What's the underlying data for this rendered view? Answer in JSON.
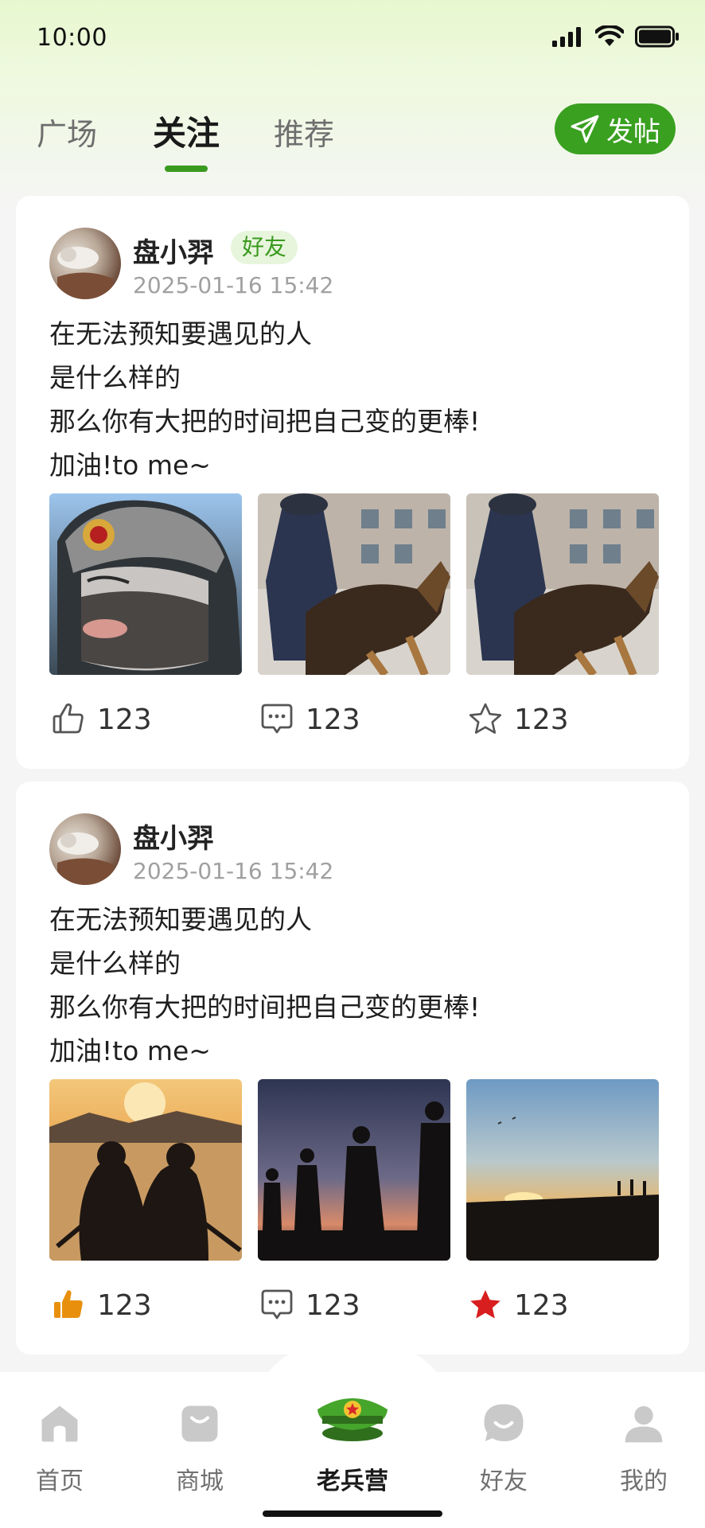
{
  "status_bar": {
    "time": "10:00"
  },
  "tabs": [
    {
      "label": "广场",
      "active": false
    },
    {
      "label": "关注",
      "active": true
    },
    {
      "label": "推荐",
      "active": false
    }
  ],
  "post_button": {
    "label": "发帖",
    "icon": "send-icon"
  },
  "posts": [
    {
      "author": "盘小羿",
      "badge": "好友",
      "time": "2025-01-16 15:42",
      "text_lines": [
        "在无法预知要遇见的人",
        "是什么样的",
        "那么你有大把的时间把自己变的更棒!",
        "加油!to me~"
      ],
      "images": [
        "soldier-fur-hat-frost",
        "police-dog-handler",
        "police-dog-handler"
      ],
      "likes": "123",
      "comments": "123",
      "favorites": "123",
      "liked": false,
      "favorited": false
    },
    {
      "author": "盘小羿",
      "badge": "",
      "time": "2025-01-16 15:42",
      "text_lines": [
        "在无法预知要遇见的人",
        "是什么样的",
        "那么你有大把的时间把自己变的更棒!",
        "加油!to me~"
      ],
      "images": [
        "soldiers-sunset-lake",
        "soldiers-march-dusk",
        "sunset-silhouettes"
      ],
      "likes": "123",
      "comments": "123",
      "favorites": "123",
      "liked": true,
      "favorited": true
    }
  ],
  "bottom_nav": [
    {
      "label": "首页",
      "icon": "home-icon",
      "active": false
    },
    {
      "label": "商城",
      "icon": "shopping-bag-icon",
      "active": false
    },
    {
      "label": "老兵营",
      "icon": "military-cap-icon",
      "active": true
    },
    {
      "label": "好友",
      "icon": "chat-bubble-icon",
      "active": false
    },
    {
      "label": "我的",
      "icon": "user-icon",
      "active": false
    }
  ],
  "colors": {
    "accent": "#3aa020",
    "like_active": "#e8900e",
    "favorite_active": "#d81e1e",
    "badge_bg": "#e7f5dc"
  }
}
